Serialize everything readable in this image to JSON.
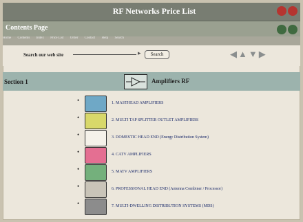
{
  "window": {
    "title": "RF Networks Price List"
  },
  "subbar": {
    "label": "Contents Page"
  },
  "navstrip": {
    "items": [
      "Home",
      "Contents",
      "Index",
      "Price List",
      "Order",
      "Contact",
      "Help",
      "Search"
    ]
  },
  "search": {
    "label": "Search our web site",
    "button": "Search"
  },
  "section": {
    "number": "Section 1",
    "title": "Amplifiers RF"
  },
  "items": [
    {
      "text": "1. MASTHEAD AMPLIFIERS",
      "color": "#6fa8c6"
    },
    {
      "text": "2. MULTI TAP SPLITTER OUTLET AMPLIFIERS",
      "color": "#d8d86a"
    },
    {
      "text": "3. DOMESTIC HEAD END (Energy Distribution System)",
      "color": "#f5f2ea"
    },
    {
      "text": "4. CATV AMPLIFIERS",
      "color": "#e46f92"
    },
    {
      "text": "5. MATV AMPLIFIERS",
      "color": "#74b07c"
    },
    {
      "text": "6. PROFESSIONAL HEAD END (Antenna Combiner / Processor)",
      "color": "#c9c4b8"
    },
    {
      "text": "7. MULTI-DWELLING DISTRIBUTION SYSTEMS (MDS)",
      "color": "#8c8c8c"
    }
  ]
}
